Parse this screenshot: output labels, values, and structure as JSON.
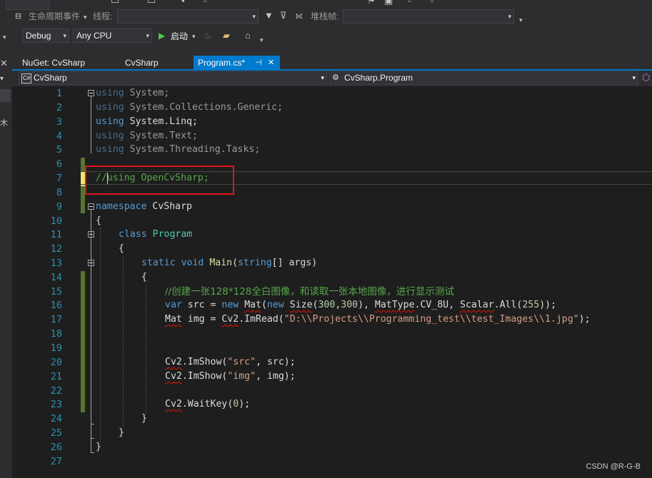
{
  "toolbar": {
    "lifecycle_label": "生命周期事件",
    "thread_label": "线程:",
    "stackframe_label": "堆栈帧:",
    "config": "Debug",
    "platform": "Any CPU",
    "start_label": "启动"
  },
  "tabs": [
    {
      "label": "NuGet: CvSharp"
    },
    {
      "label": "CvSharp"
    },
    {
      "label": "Program.cs*",
      "pin": "⊣",
      "close": "✕"
    }
  ],
  "navbar": {
    "project": "CvSharp",
    "project_badge": "C#",
    "class": "CvSharp.Program"
  },
  "editor": {
    "line_numbers": [
      "1",
      "2",
      "3",
      "4",
      "5",
      "6",
      "7",
      "8",
      "9",
      "10",
      "11",
      "12",
      "13",
      "14",
      "15",
      "16",
      "17",
      "18",
      "19",
      "20",
      "21",
      "22",
      "23",
      "24",
      "25",
      "26",
      "27"
    ],
    "tokens": {
      "using": "using",
      "system": "System",
      "semi": ";",
      "ns_generic": "System.Collections.Generic",
      "ns_linq": "System.Linq",
      "ns_text": "System.Text",
      "ns_tasks": "System.Threading.Tasks",
      "commented_using": "//using OpenCvSharp;",
      "namespace_kw": "namespace",
      "namespace_name": "CvSharp",
      "open_brace": "{",
      "close_brace": "}",
      "class_kw": "class",
      "class_name": "Program",
      "static_kw": "static",
      "void_kw": "void",
      "main_name": "Main",
      "main_params_open": "(",
      "string_kw": "string",
      "main_params_rest": "[] args)",
      "comment_cn": "//创建一张128*128全白图像，和读取一张本地图像，进行显示测试",
      "var_kw": "var",
      "src_ident": " src = ",
      "new_kw": "new",
      "mat": "Mat",
      "paren": "(",
      "size": "Size",
      "n300a": "300",
      "comma": ",",
      "n300b": "300",
      "close_paren_comma": "), ",
      "mattype": "MatType",
      "cv8u": ".CV_8U, ",
      "scalar": "Scalar",
      "all": ".All(",
      "n255": "255",
      "end_src": "));",
      "img_decl": " img = ",
      "cv2": "Cv2",
      "imread": ".ImRead(",
      "path_str": "\"D:\\\\Projects\\\\Programming_test\\\\test_Images\\\\1.jpg\"",
      "end_call": ");",
      "imshow": ".ImShow(",
      "str_src": "\"src\"",
      "arg_src": ", src);",
      "str_img": "\"img\"",
      "arg_img": ", img);",
      "waitkey": ".WaitKey(",
      "zero": "0"
    }
  },
  "watermark": "CSDN @R-G-B",
  "colors": {
    "accent": "#007acc",
    "keyword": "#569cd6",
    "type": "#4ec9b0",
    "comment": "#57a64a",
    "string": "#d69d85",
    "highlight_box": "#e0161b"
  }
}
